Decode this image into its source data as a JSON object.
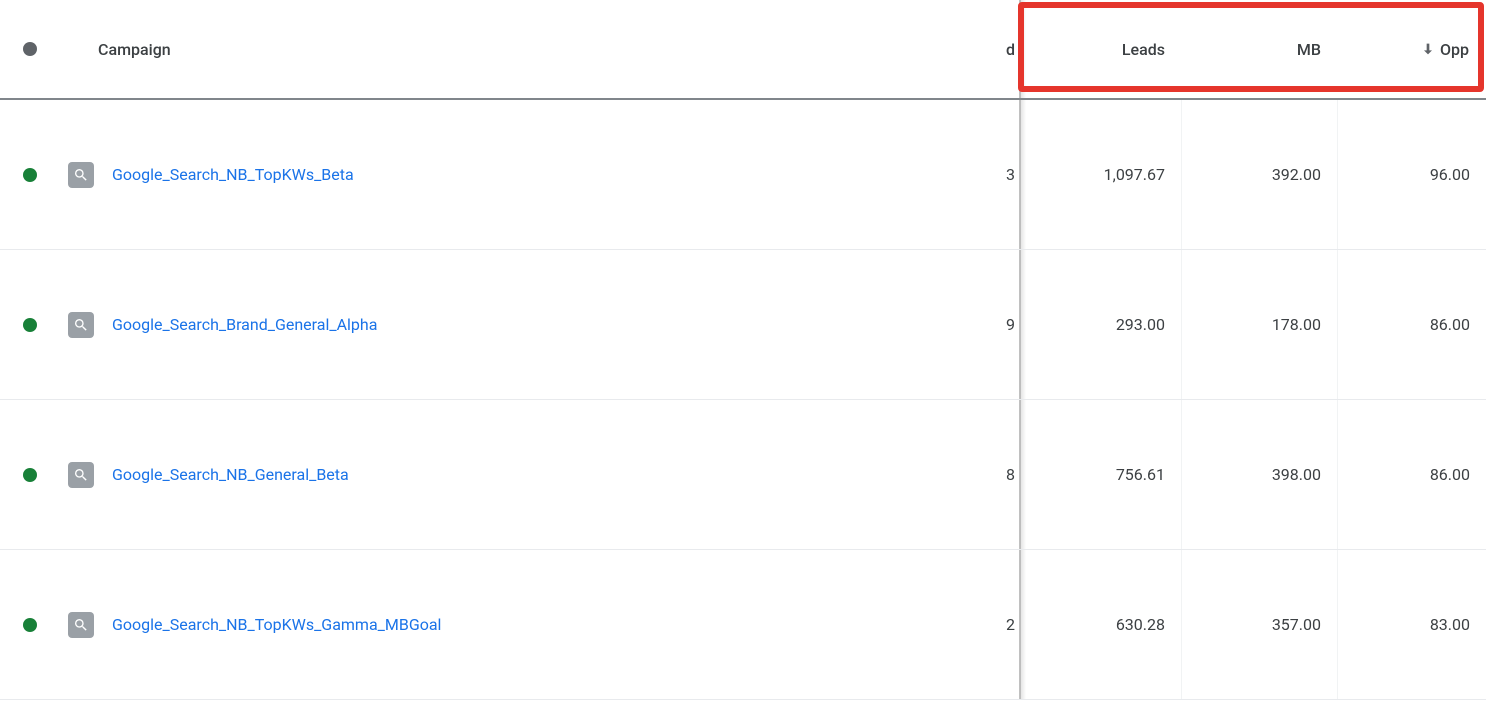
{
  "columns": {
    "campaign": "Campaign",
    "cut": "d",
    "leads": "Leads",
    "mb": "MB",
    "opp": "Opp"
  },
  "sort": {
    "column": "opp",
    "dir": "desc"
  },
  "rows": [
    {
      "status": "green",
      "name": "Google_Search_NB_TopKWs_Beta",
      "cut": "3",
      "leads": "1,097.67",
      "mb": "392.00",
      "opp": "96.00"
    },
    {
      "status": "green",
      "name": "Google_Search_Brand_General_Alpha",
      "cut": "9",
      "leads": "293.00",
      "mb": "178.00",
      "opp": "86.00"
    },
    {
      "status": "green",
      "name": "Google_Search_NB_General_Beta",
      "cut": "8",
      "leads": "756.61",
      "mb": "398.00",
      "opp": "86.00"
    },
    {
      "status": "green",
      "name": "Google_Search_NB_TopKWs_Gamma_MBGoal",
      "cut": "2",
      "leads": "630.28",
      "mb": "357.00",
      "opp": "83.00"
    }
  ]
}
